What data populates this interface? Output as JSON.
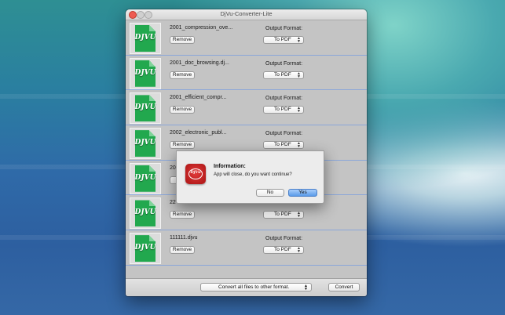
{
  "window": {
    "title": "DjVu-Converter-Lite"
  },
  "files": [
    {
      "name": "2001_compression_ove...",
      "icon_label": "DJVU",
      "remove_label": "Remove",
      "format_label": "Output Format:",
      "format_value": "To PDF"
    },
    {
      "name": "2001_doc_browsing.dj...",
      "icon_label": "DJVU",
      "remove_label": "Remove",
      "format_label": "Output Format:",
      "format_value": "To PDF"
    },
    {
      "name": "2001_efficient_compr...",
      "icon_label": "DJVU",
      "remove_label": "Remove",
      "format_label": "Output Format:",
      "format_value": "To PDF"
    },
    {
      "name": "2002_electronic_publ...",
      "icon_label": "DJVU",
      "remove_label": "Remove",
      "format_label": "Output Format:",
      "format_value": "To PDF"
    },
    {
      "name": "20",
      "icon_label": "DJVU",
      "remove_label": "",
      "format_label": "",
      "format_value": ""
    },
    {
      "name": "22",
      "icon_label": "DJVU",
      "remove_label": "Remove",
      "format_label": "",
      "format_value": "To PDF"
    },
    {
      "name": "111111.djvu",
      "icon_label": "DJVU",
      "remove_label": "Remove",
      "format_label": "Output Format:",
      "format_value": "To PDF"
    }
  ],
  "bottom": {
    "convert_all_label": "Convert all files to other format.",
    "convert_label": "Convert"
  },
  "dialog": {
    "title": "Information:",
    "message": "App will close, do you want continue?",
    "icon_label": "DjVu",
    "no_label": "No",
    "yes_label": "Yes"
  },
  "colors": {
    "accent": "#5a9be8",
    "icon_green": "#22a84e",
    "dialog_icon_red": "#c92626"
  }
}
